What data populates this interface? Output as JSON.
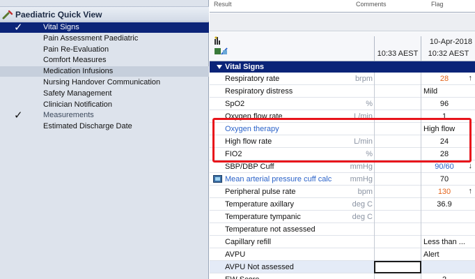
{
  "left_panel": {
    "title": "Paediatric Quick View",
    "items": [
      {
        "label": "Vital Signs",
        "state": "selected",
        "check": "✓"
      },
      {
        "label": "Pain Assessment Paediatric",
        "state": "normal",
        "check": ""
      },
      {
        "label": "Pain Re-Evaluation",
        "state": "normal",
        "check": ""
      },
      {
        "label": "Comfort Measures",
        "state": "normal",
        "check": ""
      },
      {
        "label": "Medication Infusions",
        "state": "highlight",
        "check": ""
      },
      {
        "label": "Nursing Handover Communication",
        "state": "normal",
        "check": ""
      },
      {
        "label": "Safety Management",
        "state": "normal",
        "check": ""
      },
      {
        "label": "Clinician Notification",
        "state": "normal",
        "check": ""
      },
      {
        "label": "Measurements",
        "state": "muted",
        "check": "✓"
      },
      {
        "label": "Estimated Discharge Date",
        "state": "normal",
        "check": ""
      }
    ]
  },
  "top_strip": {
    "col1": "Result",
    "col2": "Comments",
    "col3": "Flag"
  },
  "grid": {
    "date": "10-Apr-2018",
    "time1": "10:33 AEST",
    "time2": "10:32 AEST",
    "section": "Vital Signs",
    "rows": [
      {
        "name": "Respiratory rate",
        "unit": "brpm",
        "v1": "",
        "v2": "28",
        "style": "orange",
        "arrow": "↑"
      },
      {
        "name": "Respiratory distress",
        "unit": "",
        "v1": "",
        "v2": "Mild",
        "style": "left",
        "arrow": ""
      },
      {
        "name": "SpO2",
        "unit": "%",
        "v1": "",
        "v2": "96",
        "style": "",
        "arrow": ""
      },
      {
        "name": "Oxygen flow rate",
        "unit": "L/min",
        "v1": "",
        "v2": "1",
        "style": "",
        "arrow": ""
      },
      {
        "name": "Oxygen therapy",
        "unit": "",
        "v1": "",
        "v2": "High flow",
        "style": "left",
        "arrow": "",
        "name_style": "blue"
      },
      {
        "name": "High flow rate",
        "unit": "L/min",
        "v1": "",
        "v2": "24",
        "style": "",
        "arrow": ""
      },
      {
        "name": "FIO2",
        "unit": "%",
        "v1": "",
        "v2": "28",
        "style": "",
        "arrow": ""
      },
      {
        "name": "SBP/DBP Cuff",
        "unit": "mmHg",
        "v1": "",
        "v2": "90/60",
        "style": "blue",
        "arrow": "↓"
      },
      {
        "name": "Mean arterial pressure cuff calc",
        "unit": "mmHg",
        "v1": "",
        "v2": "70",
        "style": "",
        "arrow": "",
        "name_style": "blue",
        "icon": true
      },
      {
        "name": "Peripheral pulse rate",
        "unit": "bpm",
        "v1": "",
        "v2": "130",
        "style": "orange",
        "arrow": "↑"
      },
      {
        "name": "Temperature axillary",
        "unit": "deg C",
        "v1": "",
        "v2": "36.9",
        "style": "",
        "arrow": ""
      },
      {
        "name": "Temperature tympanic",
        "unit": "deg C",
        "v1": "",
        "v2": "",
        "style": "",
        "arrow": ""
      },
      {
        "name": "Temperature not assessed",
        "unit": "",
        "v1": "",
        "v2": "",
        "style": "",
        "arrow": ""
      },
      {
        "name": "Capillary refill",
        "unit": "",
        "v1": "",
        "v2": "Less than ...",
        "style": "left",
        "arrow": ""
      },
      {
        "name": "AVPU",
        "unit": "",
        "v1": "",
        "v2": "Alert",
        "style": "left",
        "arrow": ""
      },
      {
        "name": "AVPU Not assessed",
        "unit": "",
        "v1": "",
        "v2": "",
        "style": "",
        "arrow": "",
        "focus": true
      },
      {
        "name": "EW Score",
        "unit": "",
        "v1": "",
        "v2": "2",
        "style": "",
        "arrow": ""
      }
    ]
  },
  "colors": {
    "selection": "#0b2478",
    "abnormal_high": "#e4641b",
    "abnormal_low": "#2a62c9",
    "annotation": "#e8141b"
  }
}
